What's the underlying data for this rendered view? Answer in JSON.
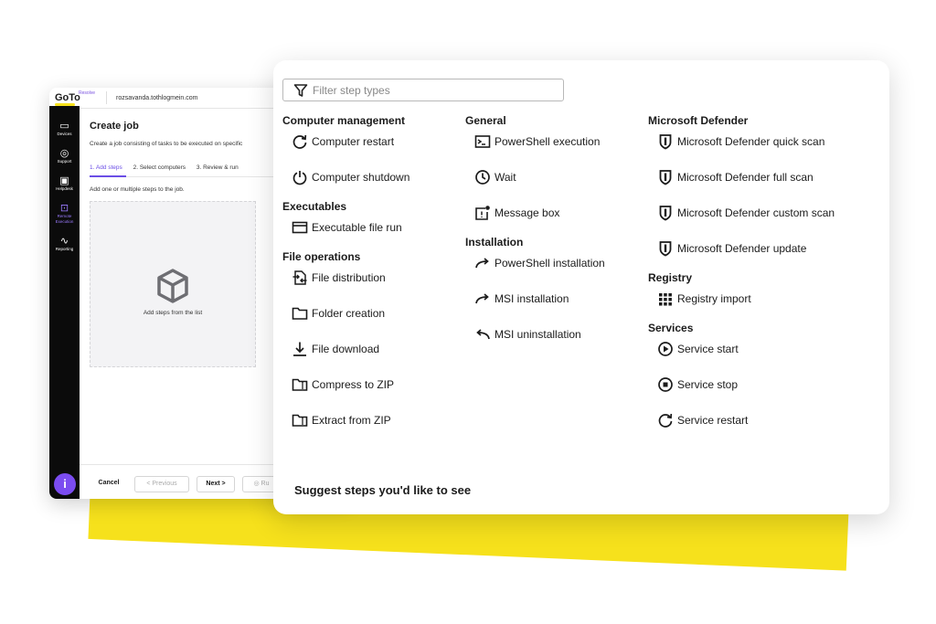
{
  "app": {
    "logo": "GoTo",
    "logo_sub": "Resolve",
    "domain": "rozsavanda.tothlogmein.com",
    "sidebar": [
      {
        "label": "Devices",
        "icon": "devices-icon"
      },
      {
        "label": "Support",
        "icon": "support-icon"
      },
      {
        "label": "Helpdesk",
        "icon": "helpdesk-icon"
      },
      {
        "label": "Remote Execution",
        "icon": "remote-execution-icon",
        "active": true
      },
      {
        "label": "Reporting",
        "icon": "reporting-icon"
      }
    ],
    "page_title": "Create job",
    "subtitle": "Create a job consisting of tasks to be executed on specific",
    "steps": [
      "1. Add steps",
      "2. Select computers",
      "3. Review & run"
    ],
    "hint": "Add one or multiple steps to the job.",
    "empty_text": "Add steps from the list",
    "footer": {
      "cancel": "Cancel",
      "previous": "< Previous",
      "next": "Next >",
      "run": "Ru"
    }
  },
  "panel": {
    "filter_placeholder": "Filter step types",
    "columns": [
      {
        "sections": [
          {
            "title": "Computer management",
            "items": [
              {
                "label": "Computer restart",
                "icon": "restart-icon"
              },
              {
                "label": "Computer shutdown",
                "icon": "power-icon"
              }
            ]
          },
          {
            "title": "Executables",
            "items": [
              {
                "label": "Executable file run",
                "icon": "window-icon"
              }
            ]
          },
          {
            "title": "File operations",
            "items": [
              {
                "label": "File distribution",
                "icon": "file-transfer-icon"
              },
              {
                "label": "Folder creation",
                "icon": "folder-icon"
              },
              {
                "label": "File download",
                "icon": "download-icon"
              },
              {
                "label": "Compress to ZIP",
                "icon": "zip-folder-icon"
              },
              {
                "label": "Extract from ZIP",
                "icon": "zip-folder-icon"
              }
            ]
          }
        ]
      },
      {
        "sections": [
          {
            "title": "General",
            "items": [
              {
                "label": "PowerShell execution",
                "icon": "terminal-icon"
              },
              {
                "label": "Wait",
                "icon": "clock-icon"
              },
              {
                "label": "Message box",
                "icon": "message-box-icon"
              }
            ]
          },
          {
            "title": "Installation",
            "items": [
              {
                "label": "PowerShell installation",
                "icon": "arrow-right-curve-icon"
              },
              {
                "label": "MSI installation",
                "icon": "arrow-right-curve-icon"
              },
              {
                "label": "MSI uninstallation",
                "icon": "arrow-left-curve-icon"
              }
            ]
          }
        ]
      },
      {
        "sections": [
          {
            "title": "Microsoft Defender",
            "items": [
              {
                "label": "Microsoft Defender quick scan",
                "icon": "defender-shield-icon"
              },
              {
                "label": "Microsoft Defender full scan",
                "icon": "defender-shield-icon"
              },
              {
                "label": "Microsoft Defender custom scan",
                "icon": "defender-shield-icon"
              },
              {
                "label": "Microsoft Defender update",
                "icon": "defender-shield-icon"
              }
            ]
          },
          {
            "title": "Registry",
            "items": [
              {
                "label": "Registry import",
                "icon": "grid-icon"
              }
            ]
          },
          {
            "title": "Services",
            "items": [
              {
                "label": "Service start",
                "icon": "play-circle-icon"
              },
              {
                "label": "Service stop",
                "icon": "stop-circle-icon"
              },
              {
                "label": "Service restart",
                "icon": "restart-icon"
              }
            ]
          }
        ]
      }
    ],
    "suggest": "Suggest steps you'd like to see"
  },
  "colors": {
    "accent": "#6b4ee6",
    "yellow": "#f6e11c",
    "sidebar": "#0b0b0b"
  }
}
